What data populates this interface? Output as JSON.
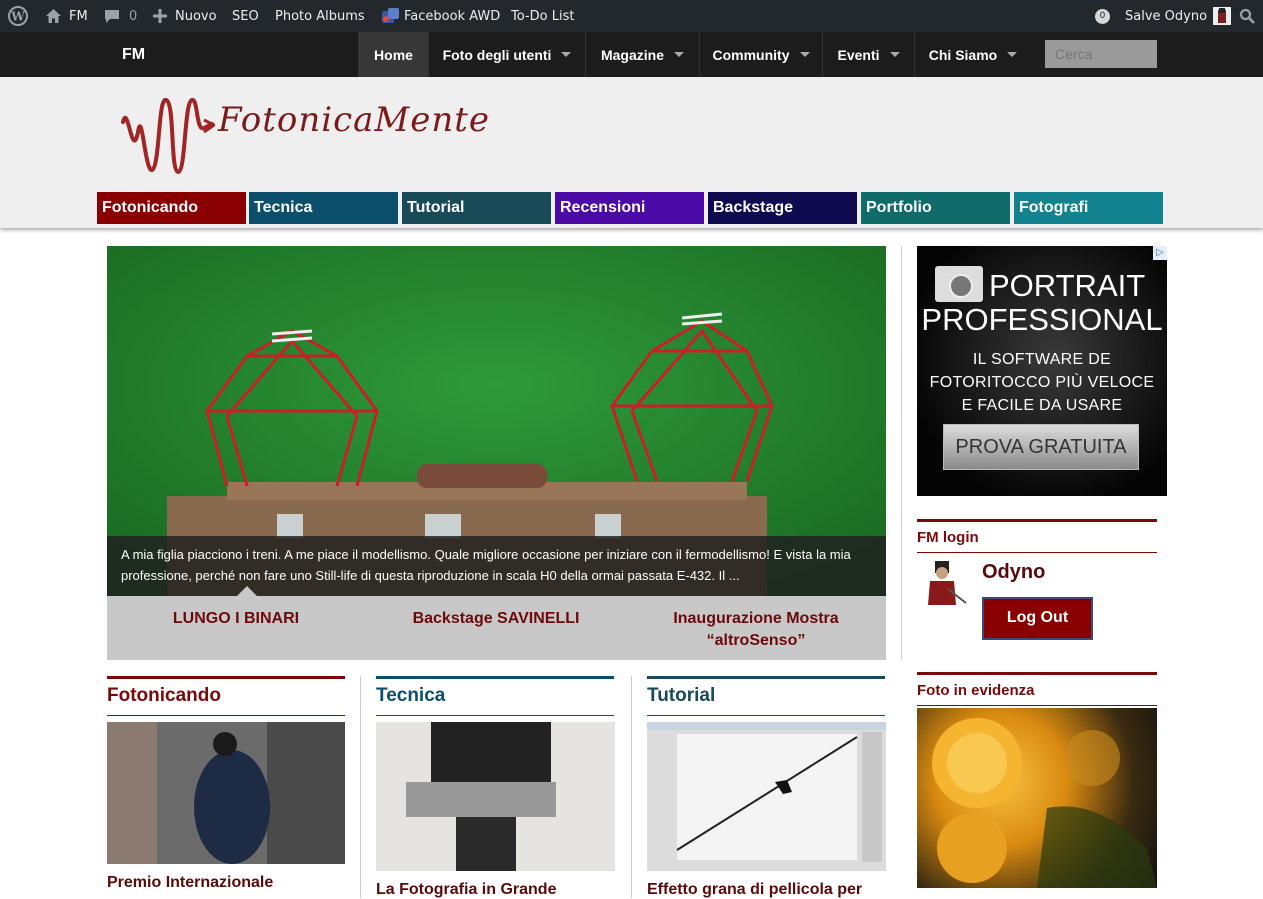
{
  "adminbar": {
    "site": "FM",
    "comments": "0",
    "new": "Nuovo",
    "seo": "SEO",
    "photo_albums": "Photo Albums",
    "facebook": "Facebook AWD",
    "todo": "To-Do List",
    "notif_count": "0",
    "greeting": "Salve Odyno"
  },
  "nav": {
    "brand": "FM",
    "items": [
      "Home",
      "Foto degli utenti",
      "Magazine",
      "Community",
      "Eventi",
      "Chi Siamo"
    ],
    "search_placeholder": "Cerca"
  },
  "logo_text": "FotonicaMente",
  "categories": [
    {
      "label": "Fotonicando",
      "color": "#8a0000"
    },
    {
      "label": "Tecnica",
      "color": "#0b4f6c"
    },
    {
      "label": "Tutorial",
      "color": "#184a57"
    },
    {
      "label": "Recensioni",
      "color": "#4b0aa6"
    },
    {
      "label": "Backstage",
      "color": "#0d0a4f"
    },
    {
      "label": "Portfolio",
      "color": "#106b6b"
    },
    {
      "label": "Fotografi",
      "color": "#12838e"
    }
  ],
  "slider": {
    "caption": "A mia figlia piacciono i treni. A me piace il modellismo. Quale migliore occasione per iniziare con il fermodellismo! E vista la mia professione, perché non fare uno Still-life di questa riproduzione in scala H0 della ormai passata E-432. Il ...",
    "tabs": [
      "LUNGO I BINARI",
      "Backstage SAVINELLI",
      "Inaugurazione Mostra “altroSenso”"
    ]
  },
  "ad": {
    "line1": "PORTRAIT",
    "line2": "PROFESSIONAL",
    "line3": "IL SOFTWARE DE",
    "line4": "FOTORITOCCO PIÙ VELOCE",
    "line5": "E FACILE DA USARE",
    "button": "PROVA GRATUITA",
    "adchoice": "▷"
  },
  "login": {
    "heading": "FM login",
    "username": "Odyno",
    "logout": "Log Out"
  },
  "featured": {
    "heading": "Foto in evidenza"
  },
  "sections": [
    {
      "heading": "Fotonicando",
      "color": "#7a0a0a",
      "title": "Premio Internazionale"
    },
    {
      "heading": "Tecnica",
      "color": "#0b4f6c",
      "title": "La Fotografia in Grande"
    },
    {
      "heading": "Tutorial",
      "color": "#184a57",
      "title": "Effetto grana di pellicola per"
    }
  ]
}
